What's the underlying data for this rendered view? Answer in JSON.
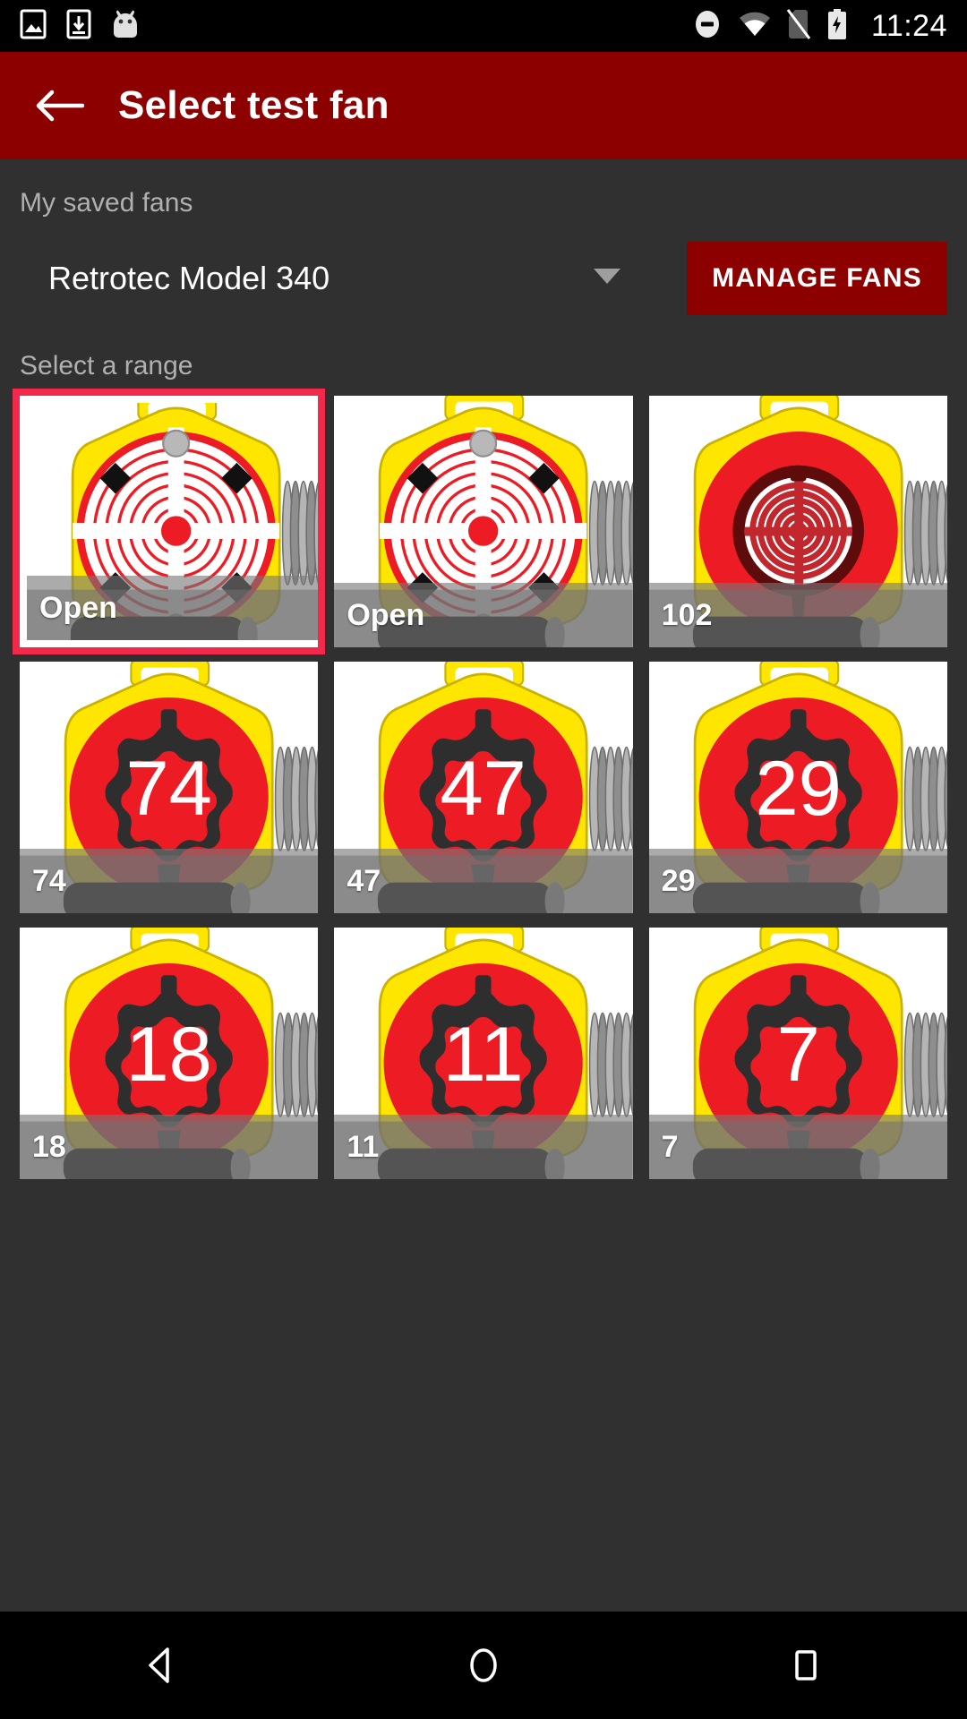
{
  "status_bar": {
    "icons": [
      "image-icon",
      "download-icon",
      "android-head-icon",
      "do-not-disturb-icon",
      "wifi-icon",
      "no-sim-icon",
      "battery-charging-icon"
    ],
    "time": "11:24"
  },
  "app_bar": {
    "back_icon": "arrow-back-icon",
    "title": "Select test fan",
    "background": "#8c0000"
  },
  "saved_fans": {
    "label": "My saved fans",
    "selected_model": "Retrotec Model 340",
    "dropdown_icon": "chevron-down-icon",
    "manage_button": "MANAGE FANS"
  },
  "range": {
    "label": "Select a range",
    "selected_index": 0,
    "selection_color": "#f2294a",
    "items": [
      {
        "label": "Open",
        "style": "open",
        "plate_number": ""
      },
      {
        "label": "Open",
        "style": "open",
        "plate_number": ""
      },
      {
        "label": "102",
        "style": "ring",
        "plate_number": ""
      },
      {
        "label": "74",
        "style": "plate",
        "plate_number": "74"
      },
      {
        "label": "47",
        "style": "plate",
        "plate_number": "47"
      },
      {
        "label": "29",
        "style": "plate",
        "plate_number": "29"
      },
      {
        "label": "18",
        "style": "plate",
        "plate_number": "18"
      },
      {
        "label": "11",
        "style": "plate",
        "plate_number": "11"
      },
      {
        "label": "7",
        "style": "plate",
        "plate_number": "7"
      }
    ]
  },
  "nav_bar": {
    "back": "nav-back-icon",
    "home": "nav-home-icon",
    "recents": "nav-recents-icon"
  },
  "colors": {
    "background": "#303030",
    "primary_dark": "#8c0000",
    "fan_yellow": "#ffe600",
    "fan_red": "#ed1c24",
    "plate_dark": "#2e2e2e"
  }
}
